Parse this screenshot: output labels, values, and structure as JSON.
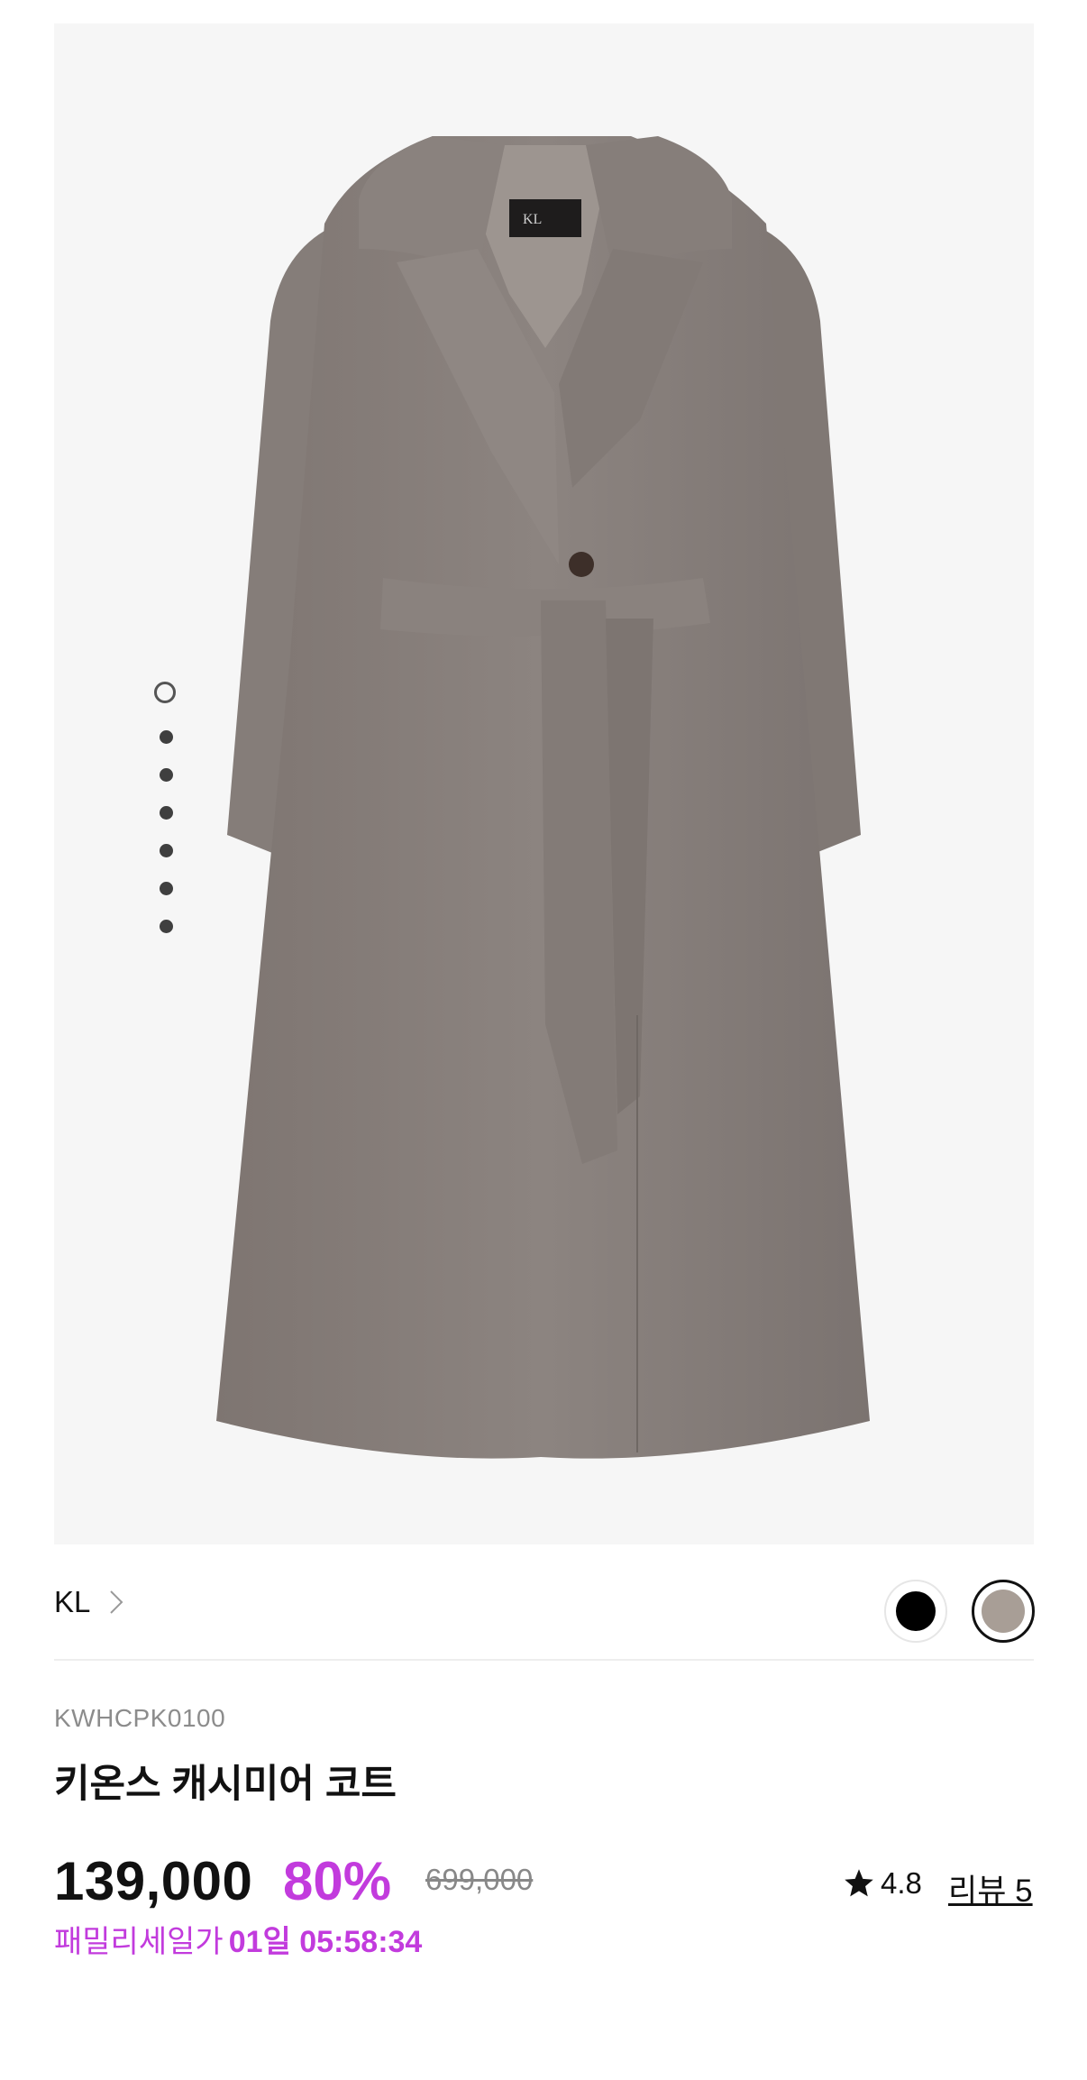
{
  "gallery": {
    "image_alt": "grey cashmere wrap coat",
    "label_on_tag": "KL",
    "indicator": {
      "total": 7,
      "active": 1
    }
  },
  "brand": {
    "name": "KL",
    "chevron_icon": "chevron-right-icon"
  },
  "colors": {
    "swatches": [
      {
        "name": "black",
        "hex": "#000000",
        "selected": false
      },
      {
        "name": "taupe",
        "hex": "#a89e96",
        "selected": true
      }
    ],
    "accent": "#c23bdd"
  },
  "product": {
    "sku": "KWHCPK0100",
    "title": "키온스 캐시미어 코트",
    "price": "139,000",
    "discount": "80%",
    "original_price": "699,000",
    "rating": "4.8",
    "reviews_label": "리뷰 5",
    "family_sale_label": "패밀리세일가",
    "countdown": "01일 05:58:34"
  }
}
